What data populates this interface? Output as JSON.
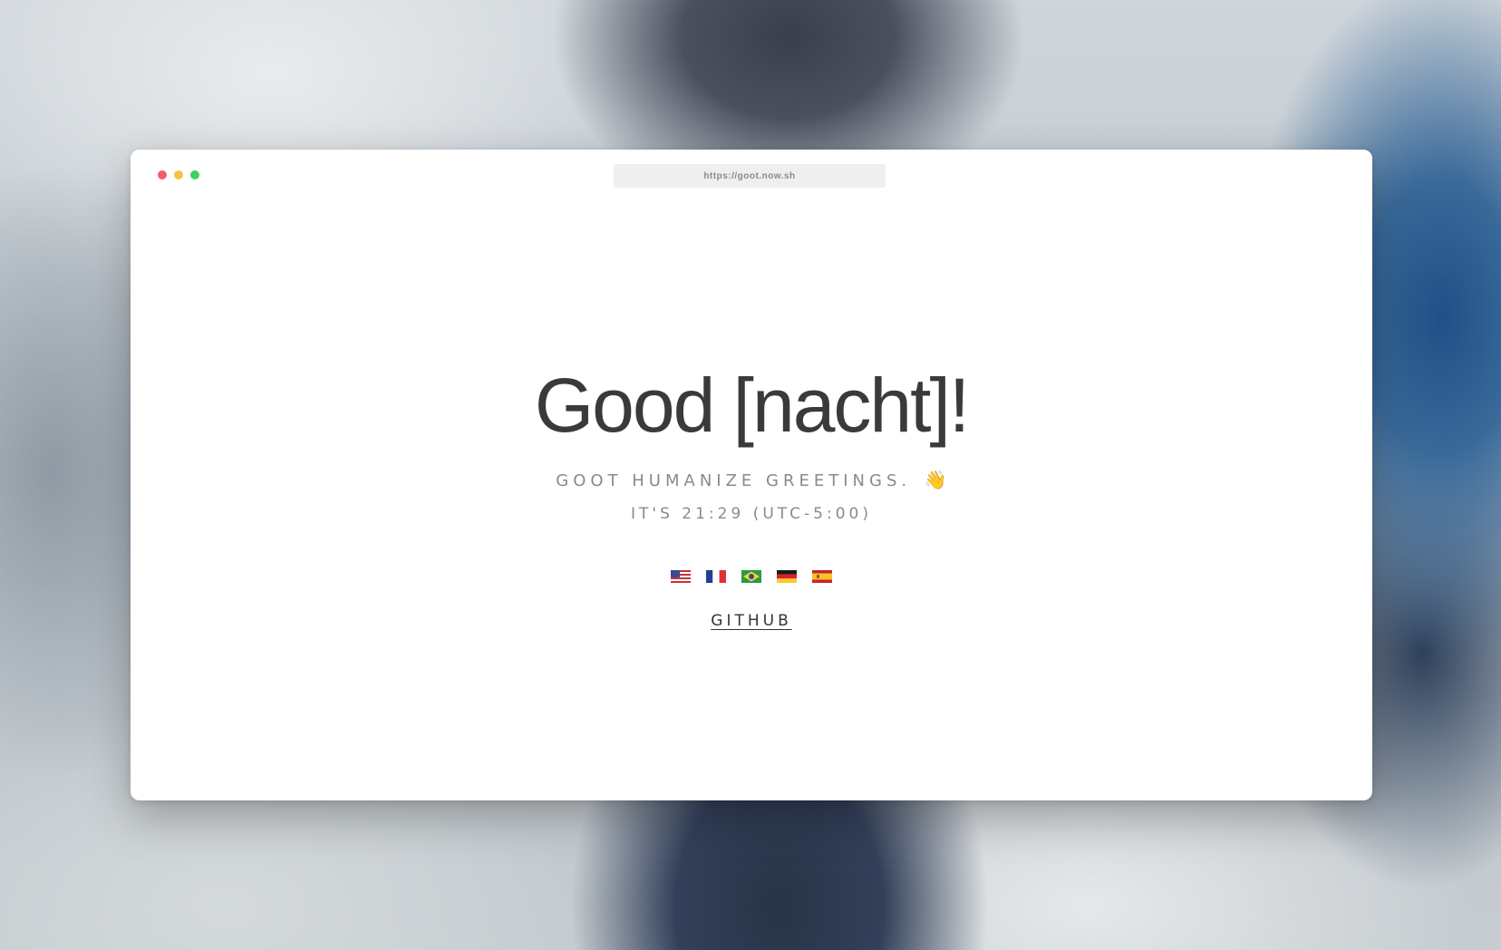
{
  "browser": {
    "url": "https://goot.now.sh"
  },
  "greeting": {
    "title": "Good [nacht]!",
    "tagline": "GOOT HUMANIZE GREETINGS.",
    "tagline_emoji": "👋",
    "time_text": "IT'S 21:29 (UTC-5:00)"
  },
  "languages": [
    {
      "icon": "flag-us-icon"
    },
    {
      "icon": "flag-fr-icon"
    },
    {
      "icon": "flag-br-icon"
    },
    {
      "icon": "flag-de-icon"
    },
    {
      "icon": "flag-es-icon"
    }
  ],
  "links": {
    "github_label": "GITHUB"
  },
  "colors": {
    "window_bg": "#ffffff",
    "title_text": "#3a3a3a",
    "muted_text": "#8a8a8a",
    "traffic_red": "#f25d69",
    "traffic_yellow": "#f7c244",
    "traffic_green": "#3ed35b"
  }
}
